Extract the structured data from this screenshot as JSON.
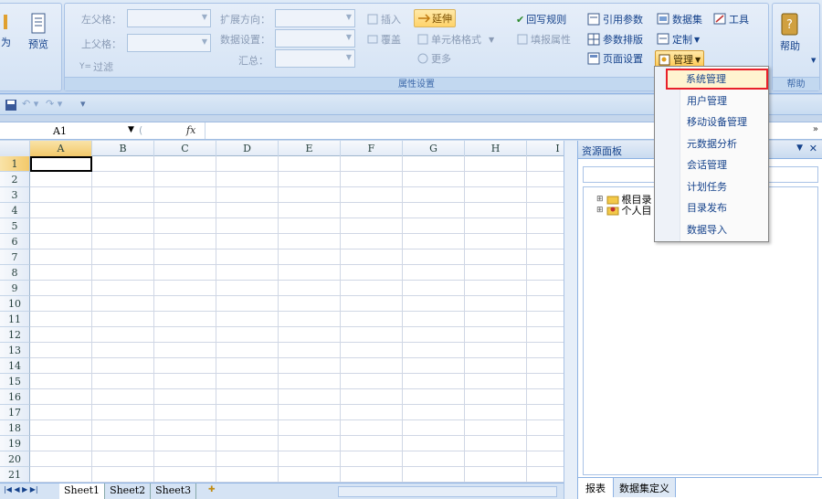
{
  "ribbon": {
    "left_group": {
      "item1": "为",
      "preview": "预览"
    },
    "fields": {
      "left_parent_label": "左父格：",
      "top_parent_label": "上父格：",
      "filter_label": "过滤",
      "expand_dir_label": "扩展方向：",
      "data_setting_label": "数据设置：",
      "summary_label": "汇总："
    },
    "buttons": {
      "insert": "插入",
      "overwrite": "覆盖",
      "extend": "延伸",
      "cell_format": "单元格格式",
      "more": "更多",
      "writeback_rule": "回写规则",
      "fill_property": "填报属性",
      "ref_param": "引用参数",
      "param_layout": "参数排版",
      "page_setup": "页面设置",
      "dataset": "数据集",
      "tools": "工具",
      "customize": "定制",
      "manage": "管理",
      "help": "帮助"
    },
    "group_labels": {
      "property": "属性设置",
      "help": "帮助"
    }
  },
  "formula": {
    "cell_ref": "A1",
    "fx": "fx"
  },
  "sheet": {
    "columns": [
      "A",
      "B",
      "C",
      "D",
      "E",
      "F",
      "G",
      "H",
      "I"
    ],
    "rows": [
      "1",
      "2",
      "3",
      "4",
      "5",
      "6",
      "7",
      "8",
      "9",
      "10",
      "11",
      "12",
      "13",
      "14",
      "15",
      "16",
      "17",
      "18",
      "19",
      "20",
      "21"
    ],
    "tabs": [
      "Sheet1",
      "Sheet2",
      "Sheet3"
    ]
  },
  "panel": {
    "title": "资源面板",
    "tree": [
      "根目录",
      "个人目"
    ],
    "bottom_tabs": [
      "报表",
      "数据集定义"
    ]
  },
  "manage_menu": {
    "items": [
      "系统管理",
      "用户管理",
      "移动设备管理",
      "元数据分析",
      "会话管理",
      "计划任务",
      "目录发布",
      "数据导入"
    ],
    "highlight_color": "#e8202a"
  }
}
